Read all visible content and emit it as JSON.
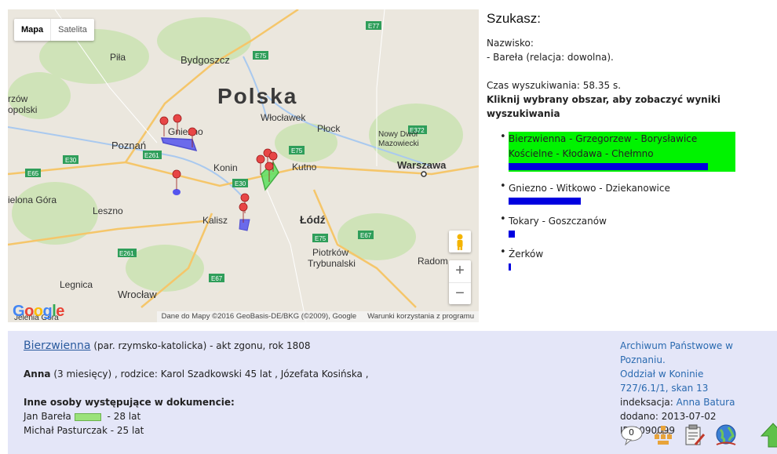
{
  "map": {
    "type_map": "Mapa",
    "type_satellite": "Satelita",
    "zoom_in": "+",
    "zoom_out": "−",
    "attribution": "Dane do Mapy ©2016 GeoBasis-DE/BKG (©2009), Google",
    "terms": "Warunki korzystania z programu",
    "logo": "Google",
    "labels": {
      "polska": "Polska",
      "bydgoszcz": "Bydgoszcz",
      "pila": "Piła",
      "gorzow": "rzów",
      "wlkp": "opolski",
      "poznan": "Poznań",
      "gniezno": "Gniezno",
      "wloclawek": "Włocławek",
      "plock": "Płock",
      "nowy_dwor": "Nowy Dwór",
      "mazowiecki": "Mazowiecki",
      "warszawa": "Warszawa",
      "konin": "Konin",
      "kutno": "Kutno",
      "zielona_gora": "ielona Góra",
      "leszno": "Leszno",
      "kalisz": "Kalisz",
      "lodz": "Łódź",
      "piotrkow": "Piotrków",
      "trybunalski": "Trybunalski",
      "radom": "Radom",
      "legnica": "Legnica",
      "wroclaw": "Wrocław",
      "jelenia": "Jelenia Góra",
      "e77": "E77",
      "e75a": "E75",
      "e75b": "E75",
      "e75c": "E75",
      "e30a": "E30",
      "e30b": "E30",
      "e261a": "E261",
      "e261b": "E261",
      "e65": "E65",
      "e67a": "E67",
      "e67b": "E67",
      "e372": "E372"
    }
  },
  "panel": {
    "title": "Szukasz:",
    "surname_label": "Nazwisko:",
    "surname_value": "- Bareła (relacja: dowolna).",
    "time": "Czas wyszukiwania: 58.35 s.",
    "instruction": "Kliknij wybrany obszar, aby zobaczyć wyniki wyszukiwania",
    "results": [
      {
        "label": "Bierzwienna - Grzegorzew - Borysławice Kościelne - Kłodawa - Chełmno",
        "value": 0.94
      },
      {
        "label": "Gniezno - Witkowo - Dziekanowice",
        "value": 0.34
      },
      {
        "label": "Tokary - Goszczanów",
        "value": 0.03
      },
      {
        "label": "Żerków",
        "value": 0.01
      }
    ],
    "colors": {
      "selected_bg": "#00f300",
      "bar": "#0000e0"
    }
  },
  "record": {
    "place": "Bierzwienna",
    "desc": "(par. rzymsko-katolicka) - akt zgonu, rok 1808",
    "person_name": "Anna",
    "person_rest": "(3 miesięcy) , rodzice: Karol Szadkowski 45 lat , Józefata Kosińska ,",
    "others_heading": "Inne osoby występujące w dokumencie:",
    "other1_name": "Jan Bareła",
    "other1_age": "- 28 lat",
    "other2": "Michał Pasturczak - 25 lat",
    "archive1": "Archiwum Państwowe w Poznaniu.",
    "archive2": "Oddział w Koninie",
    "signature": "727/6.1/1, skan 13",
    "index_label": "indeksacja:",
    "index_person": "Anna Batura",
    "added": "dodano: 2013-07-02",
    "id": "ID 1090099",
    "comment_count": "0"
  }
}
